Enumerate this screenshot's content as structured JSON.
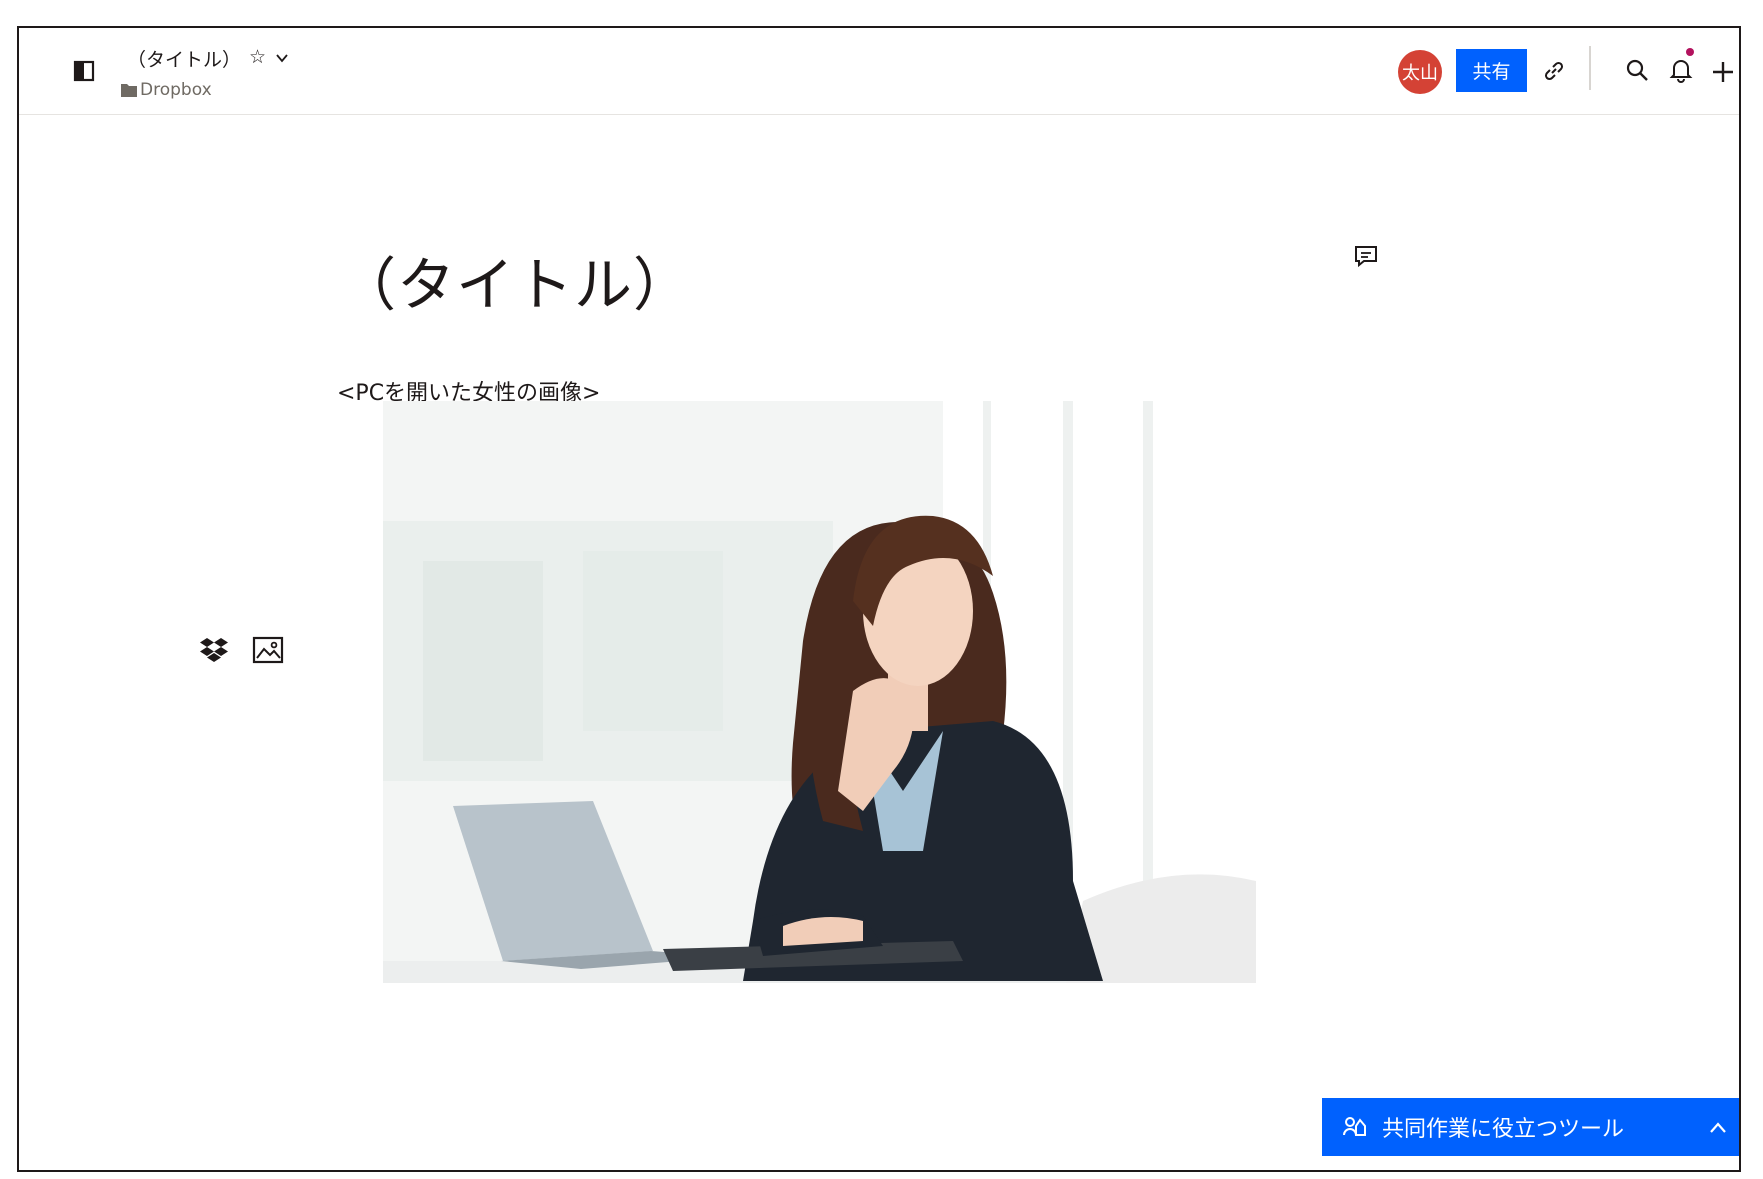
{
  "header": {
    "doc_title": "（タイトル）",
    "star_glyph": "☆",
    "folder_label": "Dropbox",
    "avatar_initials": "太山",
    "avatar_color": "#d44235",
    "share_label": "共有",
    "accent_color": "#0061fe",
    "icons": [
      "sidebar-toggle-icon",
      "star-icon",
      "chevron-down-icon",
      "folder-icon",
      "link-icon",
      "search-icon",
      "bell-icon",
      "plus-icon"
    ]
  },
  "document": {
    "title": "（タイトル）",
    "image_caption": "<PCを開いた女性の画像>"
  },
  "side_tools": {
    "icons": [
      "dropbox-icon",
      "image-icon"
    ]
  },
  "collab_panel": {
    "label": "共同作業に役立つツール",
    "icons": [
      "people-icon",
      "chevron-up-icon"
    ]
  }
}
